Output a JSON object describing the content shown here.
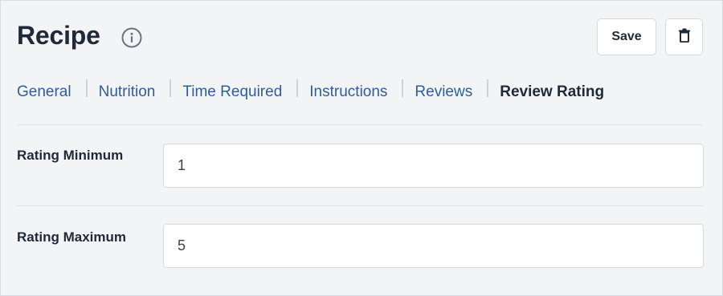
{
  "header": {
    "title": "Recipe",
    "save_label": "Save"
  },
  "icons": {
    "info": "info-icon",
    "delete": "trash-icon"
  },
  "tabs": [
    {
      "label": "General",
      "active": false
    },
    {
      "label": "Nutrition",
      "active": false
    },
    {
      "label": "Time Required",
      "active": false
    },
    {
      "label": "Instructions",
      "active": false
    },
    {
      "label": "Reviews",
      "active": false
    },
    {
      "label": "Review Rating",
      "active": true
    }
  ],
  "fields": {
    "rating_min": {
      "label": "Rating Minimum",
      "value": "1"
    },
    "rating_max": {
      "label": "Rating Maximum",
      "value": "5"
    }
  },
  "colors": {
    "tab_link": "#2c5e9e",
    "tab_active": "#1f2937",
    "background": "#f3f4f6"
  }
}
